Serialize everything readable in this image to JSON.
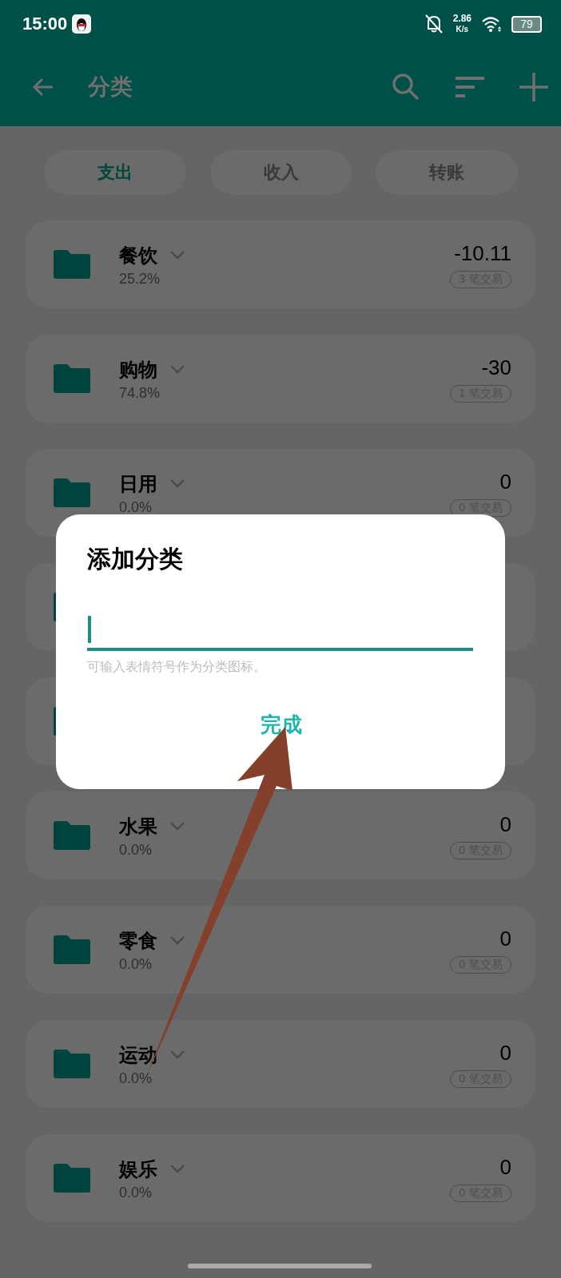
{
  "status_bar": {
    "time": "15:00",
    "speed": "2.86",
    "speed_unit": "K/s",
    "battery": "79"
  },
  "app_bar": {
    "title": "分类"
  },
  "tabs": [
    {
      "label": "支出",
      "selected": true
    },
    {
      "label": "收入",
      "selected": false
    },
    {
      "label": "转账",
      "selected": false
    }
  ],
  "categories": [
    {
      "kind": "category",
      "name": "餐饮",
      "percent": "25.2%",
      "amount": "-10.11",
      "count": "3 笔交易"
    },
    {
      "kind": "category",
      "name": "购物",
      "percent": "74.8%",
      "amount": "-30",
      "count": "1 笔交易"
    },
    {
      "kind": "category",
      "name": "日用",
      "percent": "0.0%",
      "amount": "0",
      "count": "0 笔交易"
    },
    {
      "kind": "category"
    },
    {
      "kind": "category"
    },
    {
      "kind": "category",
      "name": "水果",
      "percent": "0.0%",
      "amount": "0",
      "count": "0 笔交易"
    },
    {
      "kind": "category",
      "name": "零食",
      "percent": "0.0%",
      "amount": "0",
      "count": "0 笔交易"
    },
    {
      "kind": "category",
      "name": "运动",
      "percent": "0.0%",
      "amount": "0",
      "count": "0 笔交易"
    },
    {
      "kind": "category",
      "name": "娱乐",
      "percent": "0.0%",
      "amount": "0",
      "count": "0 笔交易"
    }
  ],
  "dialog": {
    "title": "添加分类",
    "helper": "可输入表情符号作为分类图标。",
    "button": "完成"
  }
}
